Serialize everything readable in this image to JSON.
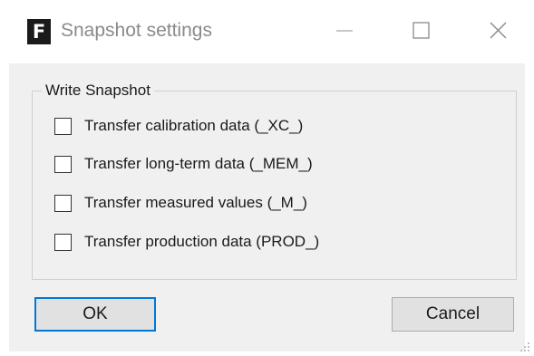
{
  "window": {
    "app_icon_letter": "F",
    "title": "Snapshot settings",
    "controls": {
      "minimize": "minimize-icon",
      "maximize": "maximize-icon",
      "close": "close-icon"
    }
  },
  "group": {
    "label": "Write Snapshot",
    "options": [
      {
        "label": "Transfer calibration data (_XC_)",
        "checked": false
      },
      {
        "label": "Transfer long-term data (_MEM_)",
        "checked": false
      },
      {
        "label": "Transfer measured values (_M_)",
        "checked": false
      },
      {
        "label": "Transfer production data (PROD_)",
        "checked": false
      }
    ]
  },
  "buttons": {
    "ok_label": "OK",
    "cancel_label": "Cancel"
  },
  "colors": {
    "client_background": "#f0f0f0",
    "focus_border": "#0078d7",
    "button_face": "#e1e1e1"
  }
}
